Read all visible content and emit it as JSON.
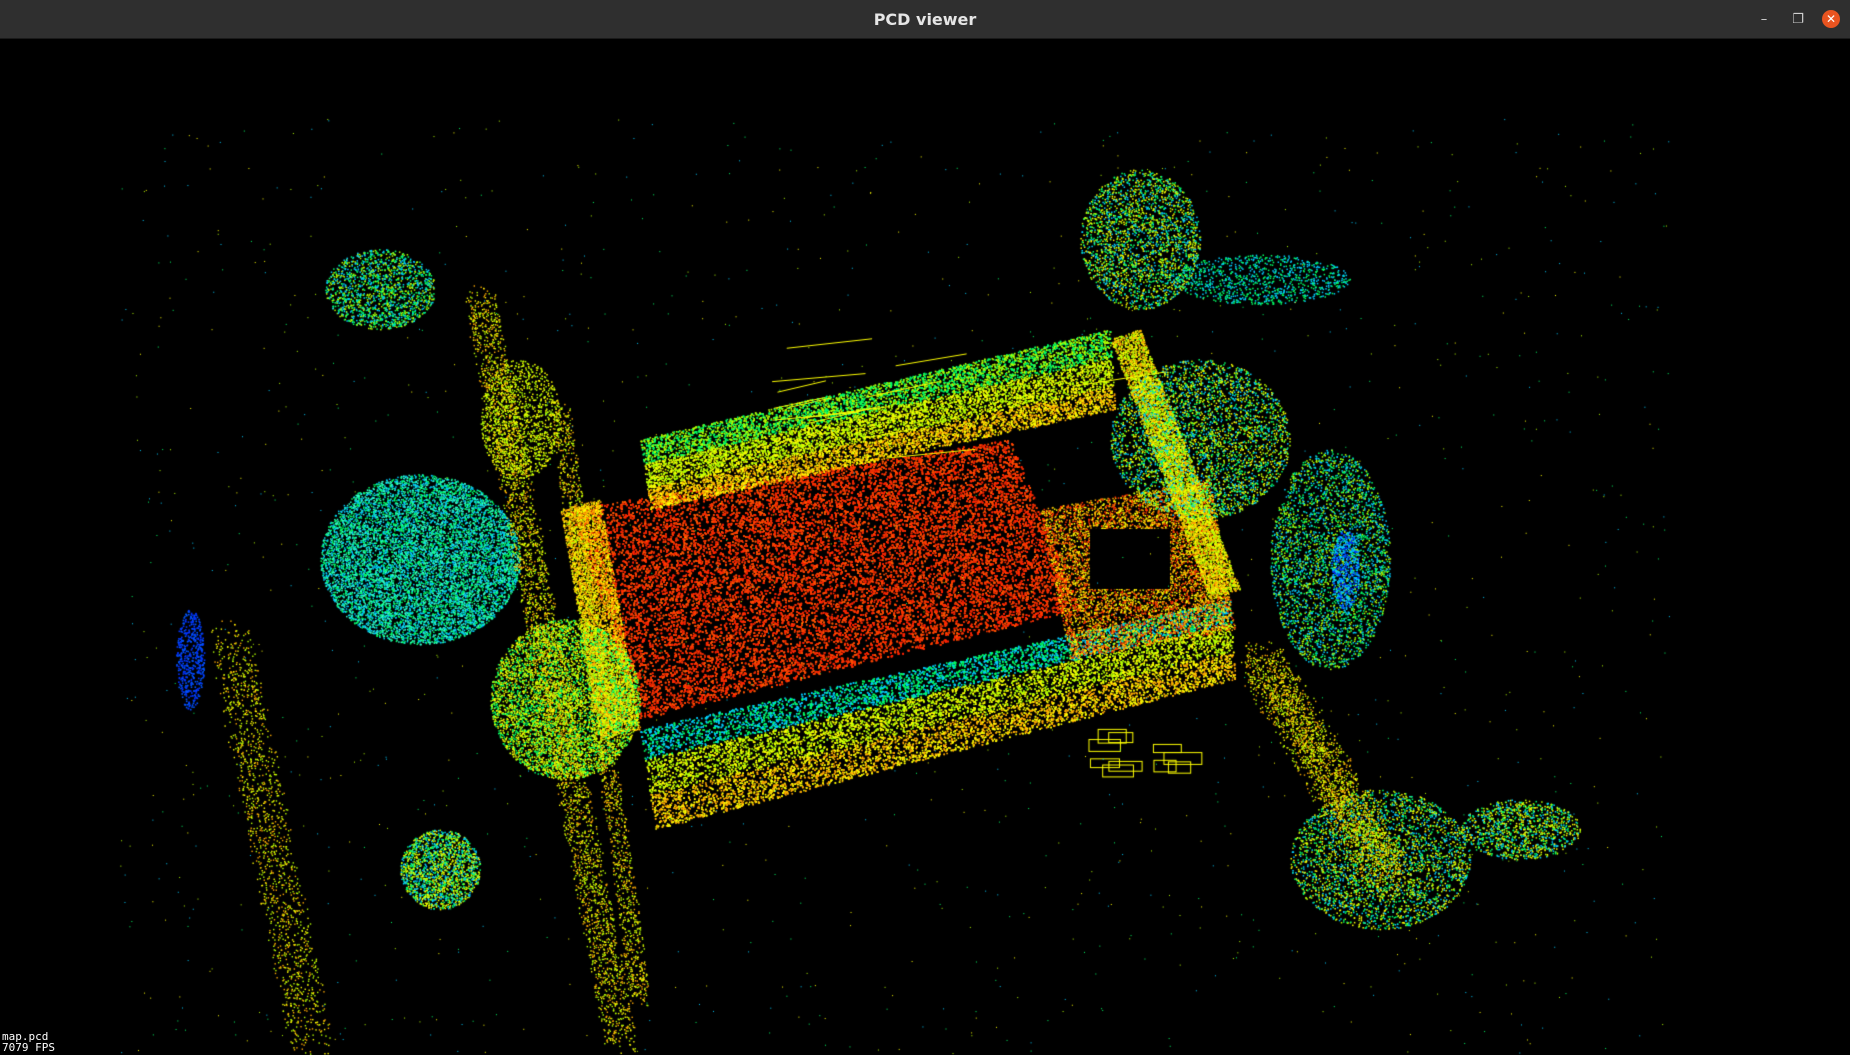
{
  "window": {
    "title": "PCD viewer",
    "minimize_glyph": "–",
    "restore_glyph": "❐",
    "close_glyph": "✕"
  },
  "viewer": {
    "background": "#000000",
    "colormap": [
      "#0033ff",
      "#00ccff",
      "#00ff66",
      "#b4ff00",
      "#ffff00",
      "#ffaa00",
      "#ff3300"
    ],
    "overlay_line1": "map.pcd",
    "overlay_line2": "7079 FPS"
  }
}
